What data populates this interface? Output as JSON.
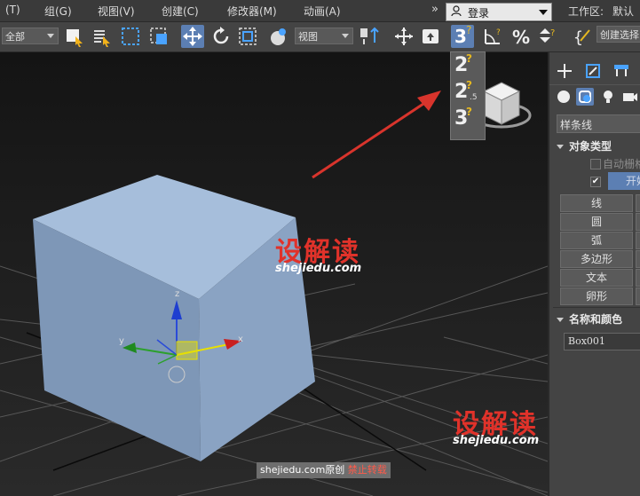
{
  "menu": {
    "items": [
      "(T)",
      "组(G)",
      "视图(V)",
      "创建(C)",
      "修改器(M)",
      "动画(A)"
    ],
    "overflow": "»",
    "login": "登录",
    "workspace_label": "工作区:",
    "workspace_value": "默认"
  },
  "toolbar": {
    "selection_filter": "全部",
    "ref_coord": "视图",
    "snap_active": "3",
    "named_selection": "创建选择"
  },
  "snap_flyout": {
    "options": [
      {
        "main": "2",
        "sub": ""
      },
      {
        "main": "2",
        "sub": ".5"
      },
      {
        "main": "3",
        "sub": ""
      }
    ]
  },
  "gizmo": {
    "x": "x",
    "y": "y",
    "z": "z"
  },
  "command_panel": {
    "category": "样条线",
    "object_type_title": "对象类型",
    "auto_grid": "自动栅格",
    "start_new": "开始",
    "buttons": [
      "线",
      "圆",
      "弧",
      "多边形",
      "文本",
      "卵形"
    ],
    "name_color_title": "名称和颜色",
    "object_name": "Box001"
  },
  "watermarks": {
    "brand_cn": "设解读",
    "brand_url": "shejiedu.com",
    "footer_url": "shejiedu.com原创",
    "footer_note": "禁止转载"
  },
  "colors": {
    "box_front": "#8fa8c7",
    "box_top": "#a9c0dd",
    "box_side": "#7f98b8",
    "active_button": "#5c7fb3",
    "arrow": "#d8342c",
    "watermark_red": "#e0322a"
  }
}
